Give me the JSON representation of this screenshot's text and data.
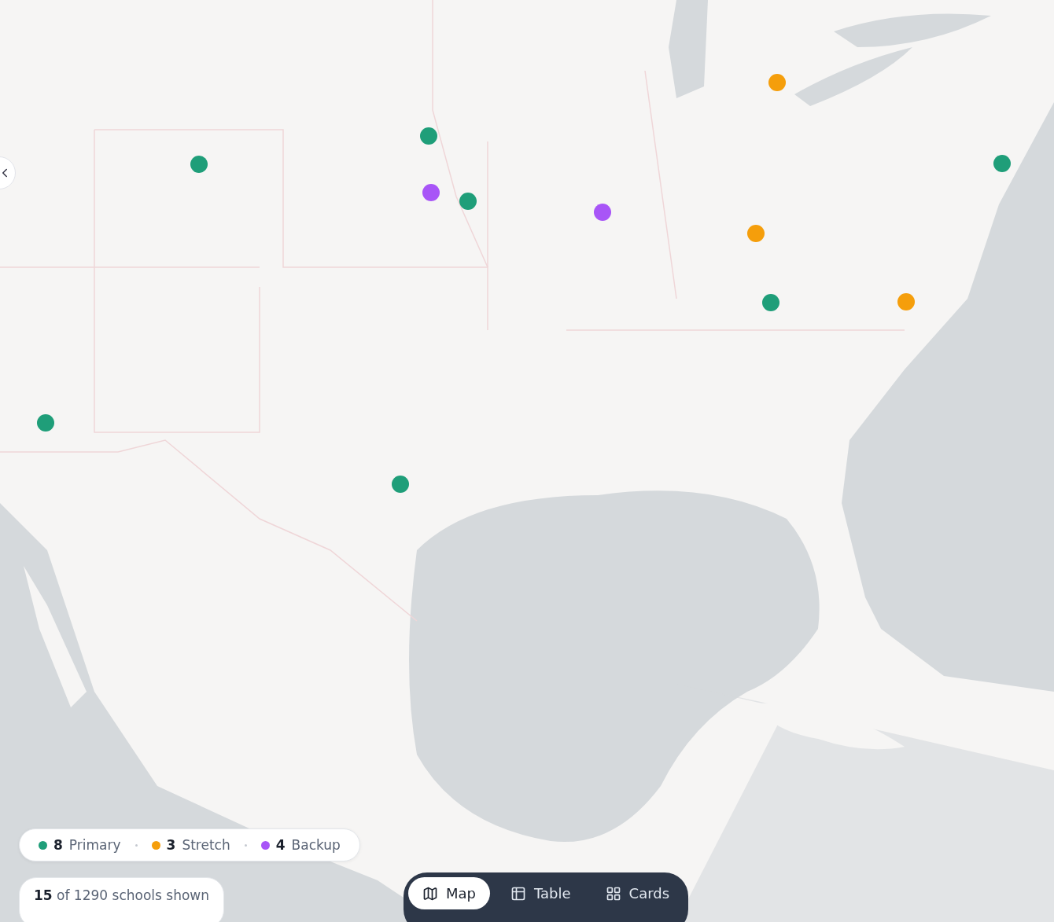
{
  "markers": [
    {
      "kind": "primary"
    },
    {
      "kind": "primary"
    },
    {
      "kind": "backup"
    },
    {
      "kind": "primary"
    },
    {
      "kind": "backup"
    },
    {
      "kind": "stretch"
    },
    {
      "kind": "stretch"
    },
    {
      "kind": "primary"
    },
    {
      "kind": "primary"
    },
    {
      "kind": "stretch"
    },
    {
      "kind": "primary"
    },
    {
      "kind": "primary"
    }
  ],
  "legend": [
    {
      "count": "8",
      "label": "Primary",
      "color": "#1f9e79"
    },
    {
      "count": "3",
      "label": "Stretch",
      "color": "#f59e0b"
    },
    {
      "count": "4",
      "label": "Backup",
      "color": "#a855f7"
    }
  ],
  "summary": "**15** of 1290 schools shown",
  "views": [
    {
      "label": "Map",
      "selected": true
    },
    {
      "label": "Table",
      "selected": false
    },
    {
      "label": "Cards",
      "selected": false
    }
  ]
}
